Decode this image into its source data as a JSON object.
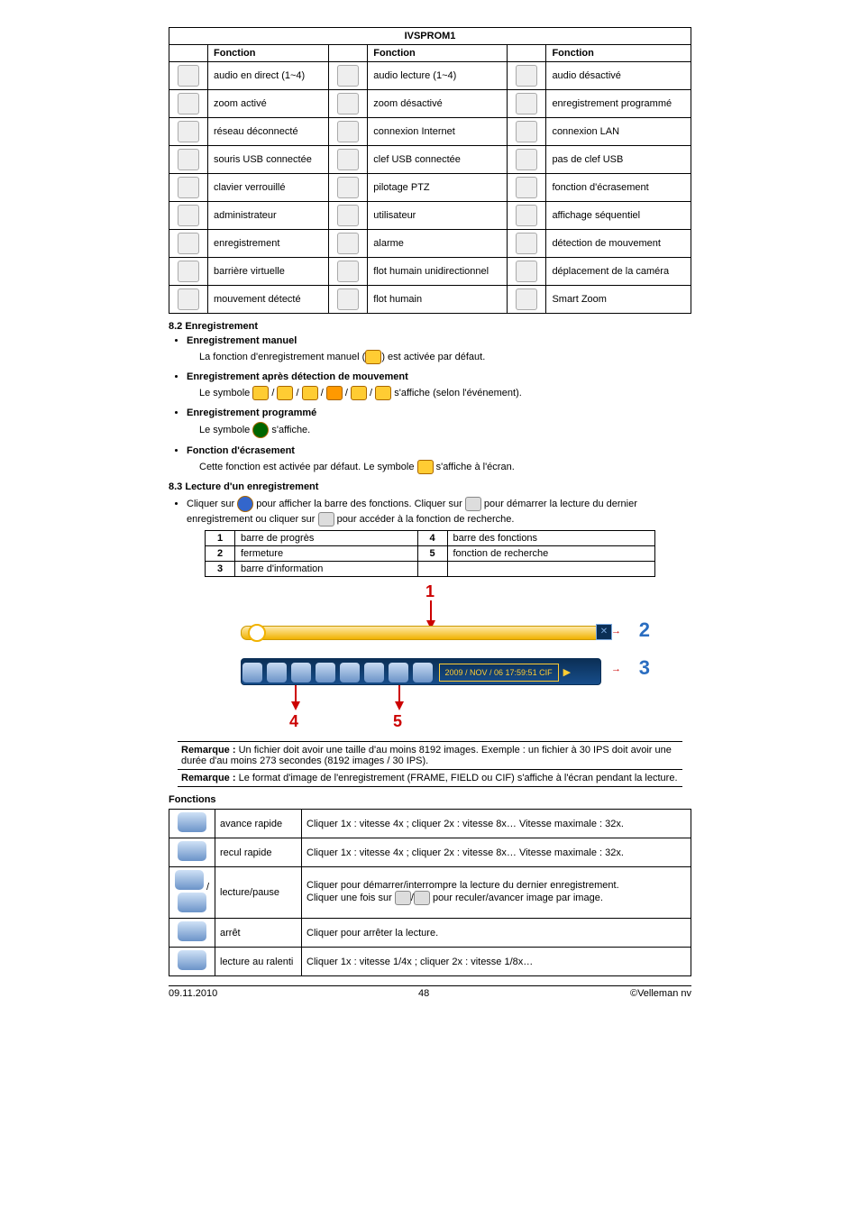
{
  "title": "IVSPROM1",
  "table_header": "Fonction",
  "rows": [
    [
      "audio en direct (1~4)",
      "audio lecture (1~4)",
      "audio désactivé"
    ],
    [
      "zoom activé",
      "zoom désactivé",
      "enregistrement programmé"
    ],
    [
      "réseau déconnecté",
      "connexion Internet",
      "connexion LAN"
    ],
    [
      "souris USB connectée",
      "clef USB connectée",
      "pas de clef USB"
    ],
    [
      "clavier verrouillé",
      "pilotage PTZ",
      "fonction d'écrasement"
    ],
    [
      "administrateur",
      "utilisateur",
      "affichage séquentiel"
    ],
    [
      "enregistrement",
      "alarme",
      "détection de mouvement"
    ],
    [
      "barrière virtuelle",
      "flot humain unidirectionnel",
      "déplacement de la caméra"
    ],
    [
      "mouvement détecté",
      "flot humain",
      "Smart Zoom"
    ]
  ],
  "sec82": {
    "title": "8.2 Enregistrement",
    "items": [
      {
        "head": "Enregistrement manuel",
        "body_pre": "La fonction d'enregistrement manuel (",
        "body_post": ") est activée par défaut."
      },
      {
        "head": "Enregistrement après détection de mouvement",
        "body_pre": "Le symbole ",
        "body_post": " s'affiche (selon l'événement)."
      },
      {
        "head": "Enregistrement programmé",
        "body_pre": "Le symbole ",
        "body_post": " s'affiche."
      },
      {
        "head": "Fonction d'écrasement",
        "body_pre": "Cette fonction est activée par défaut. Le symbole ",
        "body_post": " s'affiche à l'écran."
      }
    ]
  },
  "sec83": {
    "title": "8.3 Lecture d'un enregistrement",
    "intro_a": "Cliquer sur ",
    "intro_b": " pour afficher la barre des fonctions. Cliquer sur ",
    "intro_c": " pour démarrer la lecture du dernier enregistrement ou cliquer sur ",
    "intro_d": " pour accéder à la fonction de recherche.",
    "legend": [
      [
        "1",
        "barre de progrès",
        "4",
        "barre des fonctions"
      ],
      [
        "2",
        "fermeture",
        "5",
        "fonction de recherche"
      ],
      [
        "3",
        "barre d'information",
        "",
        ""
      ]
    ],
    "info_bar": "2009 / NOV / 06   17:59:51   CIF",
    "note1_label": "Remarque :",
    "note1": " Un fichier doit avoir une taille d'au moins 8192 images. Exemple : un fichier à 30 IPS doit avoir une durée d'au moins 273 secondes (8192 images / 30 IPS).",
    "note2_label": "Remarque :",
    "note2": " Le format d'image de l'enregistrement (FRAME, FIELD ou CIF) s'affiche à l'écran pendant la lecture."
  },
  "funcs": {
    "title": "Fonctions",
    "rows": [
      {
        "name": "avance rapide",
        "desc": "Cliquer 1x : vitesse 4x ; cliquer 2x : vitesse 8x… Vitesse maximale : 32x."
      },
      {
        "name": "recul rapide",
        "desc": "Cliquer 1x : vitesse 4x ; cliquer 2x : vitesse 8x… Vitesse maximale : 32x."
      },
      {
        "name": "lecture/pause",
        "desc_a": "Cliquer pour démarrer/interrompre la lecture du dernier enregistrement.",
        "desc_b": "Cliquer une fois sur ",
        "desc_c": " pour reculer/avancer image par image."
      },
      {
        "name": "arrêt",
        "desc": "Cliquer pour arrêter la lecture."
      },
      {
        "name": "lecture au ralenti",
        "desc": "Cliquer 1x : vitesse 1/4x ; cliquer 2x : vitesse 1/8x…"
      }
    ]
  },
  "annotations": {
    "n1": "1",
    "n2": "2",
    "n3": "3",
    "n4": "4",
    "n5": "5"
  },
  "footer": {
    "date": "09.11.2010",
    "page": "48",
    "copy": "©Velleman nv"
  }
}
